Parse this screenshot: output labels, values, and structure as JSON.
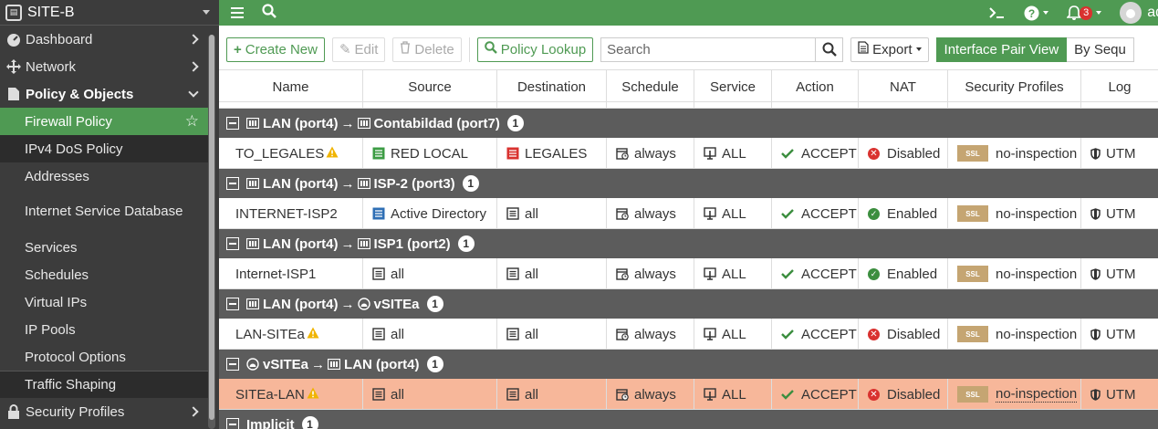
{
  "sidebar": {
    "device": "SITE-B",
    "items": [
      {
        "label": "Dashboard"
      },
      {
        "label": "Network"
      },
      {
        "label": "Policy & Objects"
      }
    ],
    "subitems": [
      {
        "label": "Firewall Policy"
      },
      {
        "label": "IPv4 DoS Policy"
      },
      {
        "label": "Addresses"
      },
      {
        "label": "Internet Service Database"
      },
      {
        "label": "Services"
      },
      {
        "label": "Schedules"
      },
      {
        "label": "Virtual IPs"
      },
      {
        "label": "IP Pools"
      },
      {
        "label": "Protocol Options"
      },
      {
        "label": "Traffic Shaping"
      }
    ],
    "bottom_item": {
      "label": "Security Profiles"
    }
  },
  "topbar": {
    "notifications_count": "3",
    "user": "ad"
  },
  "toolbar": {
    "create": "Create New",
    "edit": "Edit",
    "delete": "Delete",
    "lookup": "Policy Lookup",
    "search_placeholder": "Search",
    "export": "Export",
    "interface_view": "Interface Pair View",
    "sequence_view": "By Sequ"
  },
  "columns": [
    "Name",
    "Source",
    "Destination",
    "Schedule",
    "Service",
    "Action",
    "NAT",
    "Security Profiles",
    "Log"
  ],
  "groups": [
    {
      "from": "LAN (port4)",
      "arrow": "→",
      "to": "Contabildad (port7)",
      "count": "1",
      "policy": {
        "name": "TO_LEGALES",
        "warn": true,
        "source": "RED LOCAL",
        "destination": "LEGALES",
        "schedule": "always",
        "service": "ALL",
        "action": "ACCEPT",
        "nat": "Disabled",
        "profile": "no-inspection",
        "ssl": "SSL",
        "log": "UTM"
      }
    },
    {
      "from": "LAN (port4)",
      "arrow": "→",
      "to": "ISP-2 (port3)",
      "count": "1",
      "policy": {
        "name": "INTERNET-ISP2",
        "warn": false,
        "source": "Active Directory",
        "destination": "all",
        "schedule": "always",
        "service": "ALL",
        "action": "ACCEPT",
        "nat": "Enabled",
        "profile": "no-inspection",
        "ssl": "SSL",
        "log": "UTM"
      }
    },
    {
      "from": "LAN (port4)",
      "arrow": "→",
      "to": "ISP1 (port2)",
      "count": "1",
      "policy": {
        "name": "Internet-ISP1",
        "warn": false,
        "source": "all",
        "destination": "all",
        "schedule": "always",
        "service": "ALL",
        "action": "ACCEPT",
        "nat": "Enabled",
        "profile": "no-inspection",
        "ssl": "SSL",
        "log": "UTM"
      }
    },
    {
      "from": "LAN (port4)",
      "arrow": "→",
      "to": "vSITEa",
      "count": "1",
      "policy": {
        "name": "LAN-SITEa",
        "warn": true,
        "source": "all",
        "destination": "all",
        "schedule": "always",
        "service": "ALL",
        "action": "ACCEPT",
        "nat": "Disabled",
        "profile": "no-inspection",
        "ssl": "SSL",
        "log": "UTM"
      }
    },
    {
      "from": "vSITEa",
      "arrow": "→",
      "to": "LAN (port4)",
      "count": "1",
      "policy": {
        "name": "SITEa-LAN",
        "warn": true,
        "source": "all",
        "destination": "all",
        "schedule": "always",
        "service": "ALL",
        "action": "ACCEPT",
        "nat": "Disabled",
        "profile": "no-inspection",
        "ssl": "SSL",
        "log": "UTM"
      }
    }
  ],
  "implicit": {
    "label": "Implicit",
    "count": "1"
  },
  "colors": {
    "brand": "#4f9a53",
    "sidebar": "#3c3c3c",
    "group": "#5c5c5c",
    "highlight": "#f7b79a"
  }
}
